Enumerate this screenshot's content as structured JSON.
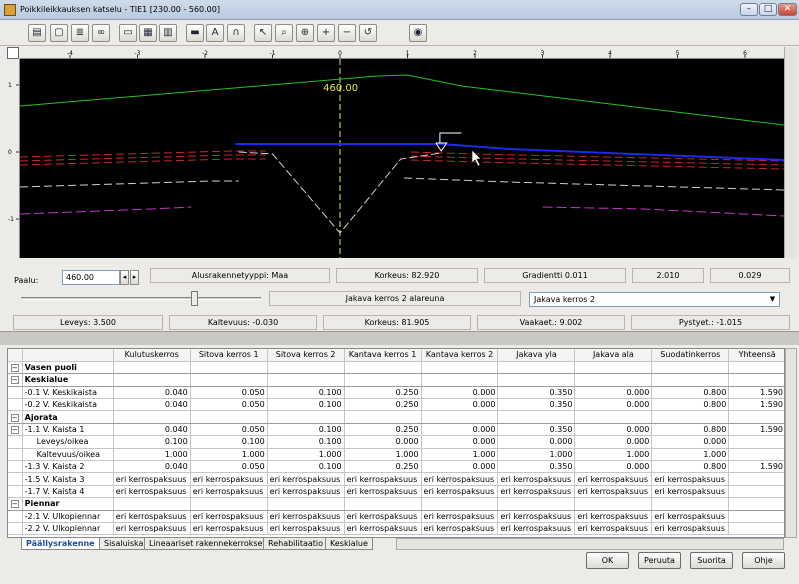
{
  "window": {
    "title": "Poikkileikkauksen katselu - TIE1  [230.00 - 560.00]"
  },
  "toolbar": {
    "icons": [
      "open-icon",
      "new-icon",
      "layers-icon",
      "link-icon",
      "frame-icon",
      "grid-icon",
      "table-icon",
      "line-icon",
      "text-icon",
      "magnet-icon",
      "pointer-icon",
      "zoom-window-icon",
      "zoom-extents-icon",
      "zoom-in-icon",
      "zoom-out-icon",
      "zoom-previous-icon",
      "palette-icon"
    ]
  },
  "viewer": {
    "x_ticks": [
      "-4",
      "-3",
      "-2",
      "-1",
      "0",
      "1",
      "2",
      "3",
      "4",
      "5",
      "6"
    ],
    "y_ticks": [
      "1",
      "0",
      "-1"
    ],
    "station_label": "460.00",
    "colors": {
      "background": "#000000",
      "terrain": "#22c322",
      "surface": "#1b2be8",
      "layer": "#d0d0d0",
      "red_layer": "#c42a2a",
      "magenta_layer": "#c238c2",
      "centerline": "#e8e840"
    }
  },
  "info": {
    "paalu_label": "Paalu:",
    "paalu_value": "460.00",
    "alusrakenne": "Alusrakennetyyppi: Maa",
    "korkeus1": "Korkeus: 82.920",
    "gradientti": "Gradientti 0.011",
    "value1": "2.010",
    "value2": "0.029",
    "layer_name": "Jakava kerros 2 alareuna",
    "layer_select": "Jakava kerros 2",
    "leveys": "Leveys: 3.500",
    "kaltevuus": "Kaltevuus: -0.030",
    "korkeus2": "Korkeus: 81.905",
    "vaakaet": "Vaakaet.: 9.002",
    "pystyet": "Pystyet.: -1.015"
  },
  "table": {
    "headers": [
      "Kulutuskerros",
      "Sitova kerros 1",
      "Sitova kerros 2",
      "Kantava kerros 1",
      "Kantava kerros 2",
      "Jakava yla",
      "Jakava ala",
      "Suodatinkerros",
      "Yhteensä"
    ],
    "rows": [
      {
        "type": "group",
        "expander": "−",
        "name": "Vasen puoli",
        "cells": [
          "",
          "",
          "",
          "",
          "",
          "",
          "",
          "",
          ""
        ]
      },
      {
        "type": "group",
        "expander": "−",
        "name": "Keskialue",
        "cells": [
          "",
          "",
          "",
          "",
          "",
          "",
          "",
          "",
          ""
        ]
      },
      {
        "type": "row",
        "expander": "",
        "name": "-0.1 V. Keskikaista",
        "cells": [
          "0.040",
          "0.050",
          "0.100",
          "0.250",
          "0.000",
          "0.350",
          "0.000",
          "0.800",
          "1.590"
        ]
      },
      {
        "type": "row",
        "expander": "",
        "name": "-0.2 V. Keskikaista",
        "cells": [
          "0.040",
          "0.050",
          "0.100",
          "0.250",
          "0.000",
          "0.350",
          "0.000",
          "0.800",
          "1.590"
        ]
      },
      {
        "type": "group",
        "expander": "−",
        "name": "Ajorata",
        "cells": [
          "",
          "",
          "",
          "",
          "",
          "",
          "",
          "",
          ""
        ]
      },
      {
        "type": "row",
        "expander": "−",
        "name": "-1.1 V. Kaista 1",
        "cells": [
          "0.040",
          "0.050",
          "0.100",
          "0.250",
          "0.000",
          "0.350",
          "0.000",
          "0.800",
          "1.590"
        ]
      },
      {
        "type": "sub",
        "expander": "",
        "name": "Leveys/oikea",
        "cells": [
          "0.100",
          "0.100",
          "0.100",
          "0.000",
          "0.000",
          "0.000",
          "0.000",
          "0.000",
          ""
        ]
      },
      {
        "type": "sub",
        "expander": "",
        "name": "Kaltevuus/oikea",
        "cells": [
          "1.000",
          "1.000",
          "1.000",
          "1.000",
          "1.000",
          "1.000",
          "1.000",
          "1.000",
          ""
        ]
      },
      {
        "type": "row",
        "expander": "",
        "name": "-1.3 V. Kaista 2",
        "cells": [
          "0.040",
          "0.050",
          "0.100",
          "0.250",
          "0.000",
          "0.350",
          "0.000",
          "0.800",
          "1.590"
        ]
      },
      {
        "type": "row",
        "expander": "",
        "name": "-1.5 V. Kaista 3",
        "cells": [
          "eri kerrospaksuus",
          "eri kerrospaksuus",
          "eri kerrospaksuus",
          "eri kerrospaksuus",
          "eri kerrospaksuus",
          "eri kerrospaksuus",
          "eri kerrospaksuus",
          "eri kerrospaksuus",
          ""
        ]
      },
      {
        "type": "row",
        "expander": "",
        "name": "-1.7 V. Kaista 4",
        "cells": [
          "eri kerrospaksuus",
          "eri kerrospaksuus",
          "eri kerrospaksuus",
          "eri kerrospaksuus",
          "eri kerrospaksuus",
          "eri kerrospaksuus",
          "eri kerrospaksuus",
          "eri kerrospaksuus",
          ""
        ]
      },
      {
        "type": "group",
        "expander": "−",
        "name": "Piennar",
        "cells": [
          "",
          "",
          "",
          "",
          "",
          "",
          "",
          "",
          ""
        ]
      },
      {
        "type": "row",
        "expander": "",
        "name": "-2.1 V. Ulkopiennar",
        "cells": [
          "eri kerrospaksuus",
          "eri kerrospaksuus",
          "eri kerrospaksuus",
          "eri kerrospaksuus",
          "eri kerrospaksuus",
          "eri kerrospaksuus",
          "eri kerrospaksuus",
          "eri kerrospaksuus",
          ""
        ]
      },
      {
        "type": "row",
        "expander": "",
        "name": "-2.2 V. Ulkopiennar",
        "cells": [
          "eri kerrospaksuus",
          "eri kerrospaksuus",
          "eri kerrospaksuus",
          "eri kerrospaksuus",
          "eri kerrospaksuus",
          "eri kerrospaksuus",
          "eri kerrospaksuus",
          "eri kerrospaksuus",
          ""
        ]
      }
    ]
  },
  "tabs": [
    "Päällysrakenne",
    "Sisaluiska",
    "Lineaariset rakennekerrokset",
    "Rehabilitaatio",
    "Keskialue"
  ],
  "buttons": {
    "ok": "OK",
    "cancel": "Peruuta",
    "apply": "Suorita",
    "help": "Ohje"
  }
}
